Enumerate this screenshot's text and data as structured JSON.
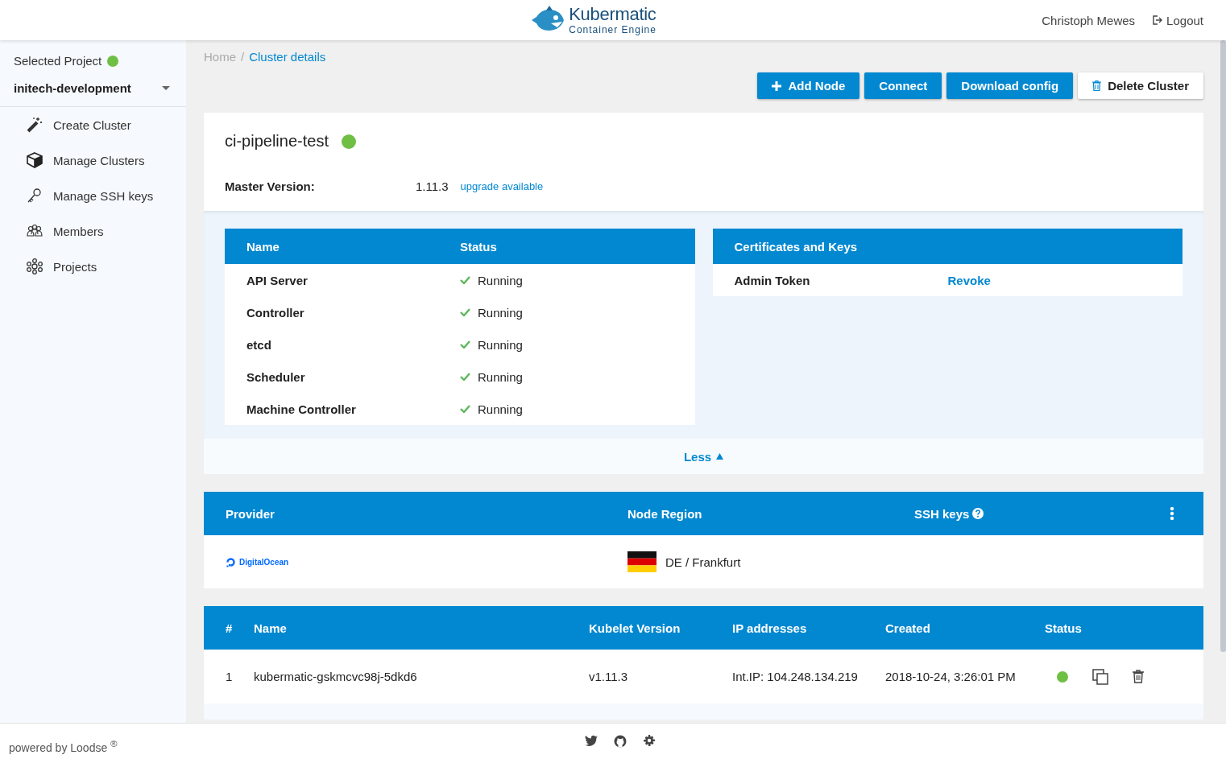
{
  "header": {
    "logo": {
      "title": "Kubermatic",
      "subtitle": "Container Engine"
    },
    "user": "Christoph Mewes",
    "logout": "Logout"
  },
  "sidebar": {
    "project_label": "Selected Project",
    "project_active": true,
    "project": "initech-development",
    "items": [
      {
        "label": "Create Cluster"
      },
      {
        "label": "Manage Clusters"
      },
      {
        "label": "Manage SSH keys"
      },
      {
        "label": "Members"
      },
      {
        "label": "Projects"
      }
    ]
  },
  "breadcrumb": {
    "separator": "/",
    "items": [
      {
        "label": "Home",
        "current": false
      },
      {
        "label": "Cluster details",
        "current": true
      }
    ]
  },
  "actions": [
    {
      "label": "Add Node",
      "kind": "add"
    },
    {
      "label": "Connect",
      "kind": "primary"
    },
    {
      "label": "Download config",
      "kind": "primary"
    },
    {
      "label": "Delete Cluster",
      "kind": "delete"
    }
  ],
  "cluster": {
    "name": "ci-pipeline-test",
    "healthy": true,
    "version_label": "Master Version:",
    "version": "1.11.3",
    "upgrade": "upgrade available"
  },
  "health": {
    "columns": [
      "Name",
      "Status"
    ],
    "rows": [
      {
        "name": "API Server",
        "status": "Running",
        "ok": true
      },
      {
        "name": "Controller",
        "status": "Running",
        "ok": true
      },
      {
        "name": "etcd",
        "status": "Running",
        "ok": true
      },
      {
        "name": "Scheduler",
        "status": "Running",
        "ok": true
      },
      {
        "name": "Machine Controller",
        "status": "Running",
        "ok": true
      }
    ]
  },
  "certificates": {
    "title": "Certificates and Keys",
    "rows": [
      {
        "name": "Admin Token",
        "action": "Revoke"
      }
    ]
  },
  "toggle": {
    "label": "Less",
    "expanded": true
  },
  "provider_table": {
    "columns": [
      "Provider",
      "Node Region",
      "SSH keys"
    ],
    "provider": "DigitalOcean",
    "region": "DE / Frankfurt"
  },
  "nodes": {
    "columns": [
      "#",
      "Name",
      "Kubelet Version",
      "IP addresses",
      "Created",
      "Status"
    ],
    "rows": [
      {
        "index": "1",
        "name": "kubermatic-gskmcvc98j-5dkd6",
        "version": "v1.11.3",
        "ip": "Int.IP: 104.248.134.219",
        "created": "2018-10-24, 3:26:01 PM",
        "ready": true
      }
    ]
  },
  "footer": {
    "powered": "powered by Loodse $^{®}$"
  }
}
